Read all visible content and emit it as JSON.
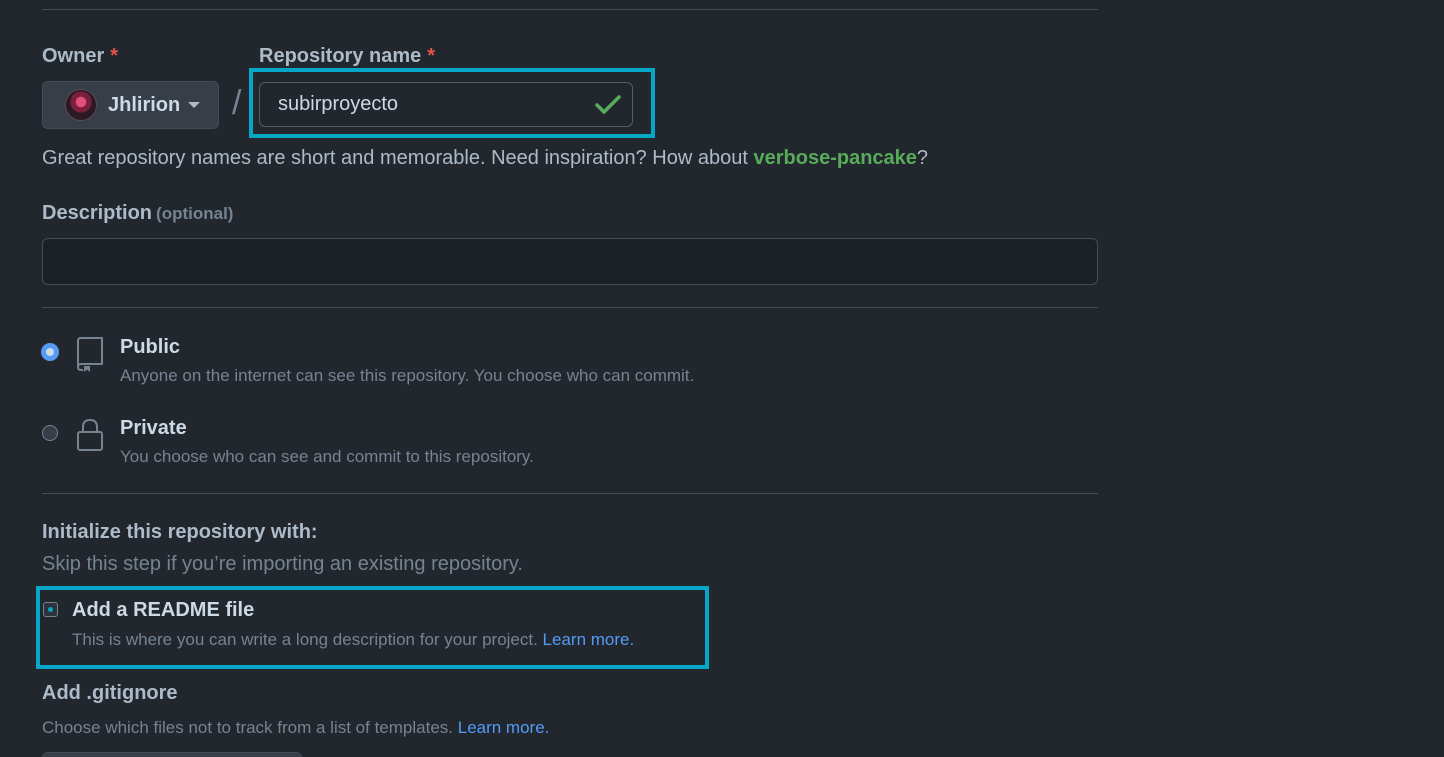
{
  "owner": {
    "label": "Owner",
    "required_mark": "*",
    "selected": "Jhlirion"
  },
  "separator": "/",
  "repository_name": {
    "label": "Repository name",
    "required_mark": "*",
    "value": "subirproyecto",
    "status_icon": "check-icon"
  },
  "name_hint": {
    "text": "Great repository names are short and memorable. Need inspiration? How about ",
    "suggestion": "verbose-pancake",
    "suffix": "?"
  },
  "description": {
    "label": "Description",
    "optional": "(optional)",
    "value": ""
  },
  "visibility": [
    {
      "title": "Public",
      "description": "Anyone on the internet can see this repository. You choose who can commit.",
      "icon": "repo-book-icon",
      "selected": true
    },
    {
      "title": "Private",
      "description": "You choose who can see and commit to this repository.",
      "icon": "lock-icon",
      "selected": false
    }
  ],
  "initialize": {
    "heading": "Initialize this repository with:",
    "subtext": "Skip this step if you’re importing an existing repository.",
    "readme": {
      "title": "Add a README file",
      "description": "This is where you can write a long description for your project. ",
      "link": "Learn more."
    }
  },
  "gitignore": {
    "heading": "Add .gitignore",
    "description": "Choose which files not to track from a list of templates. ",
    "link": "Learn more."
  },
  "colors": {
    "background": "#22272e",
    "highlight": "#06a6c8",
    "accent_green": "#57ab5a",
    "link_blue": "#539bf5",
    "required_red": "#e5534b"
  }
}
